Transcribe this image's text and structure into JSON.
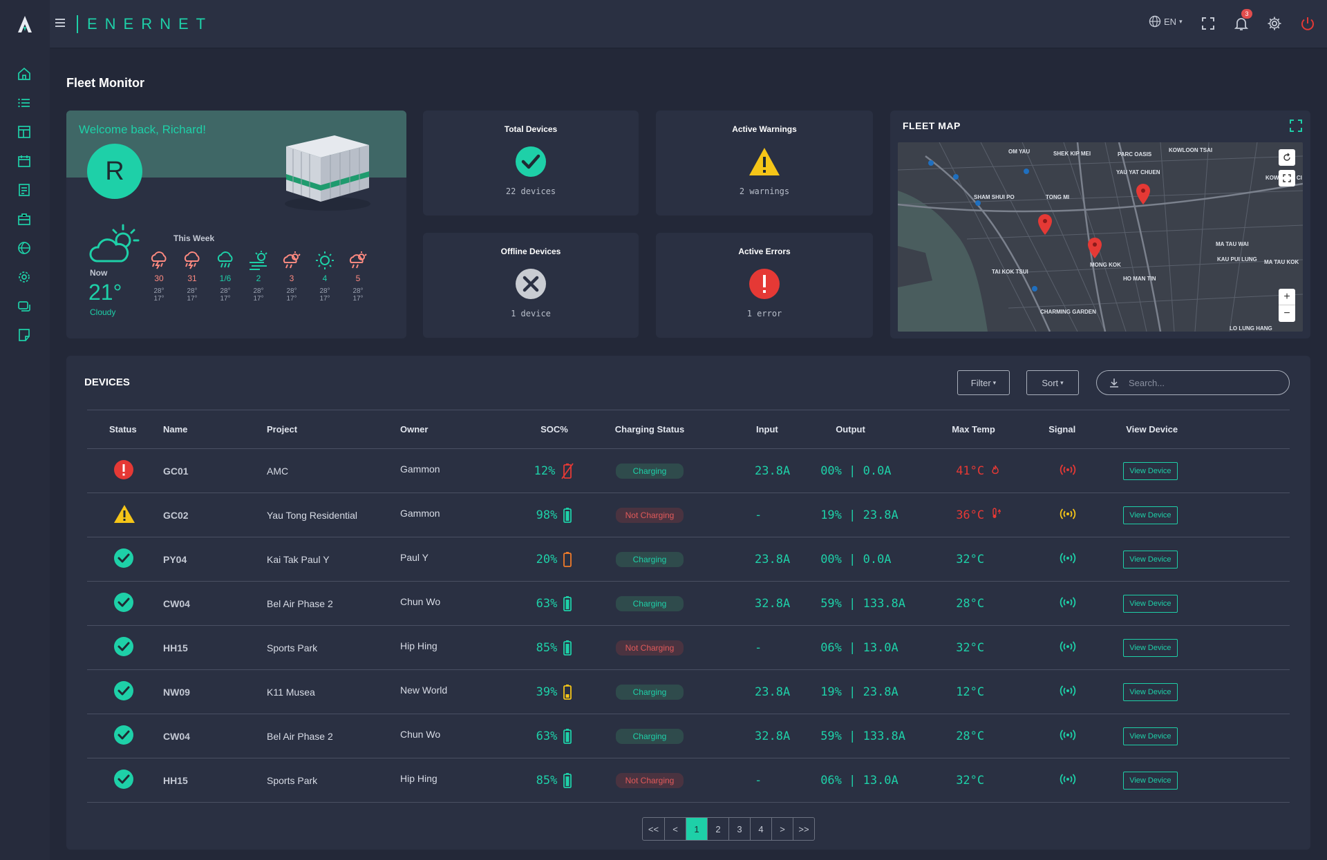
{
  "app": {
    "brand": "ENERNET",
    "language": "EN",
    "notification_count": "3"
  },
  "page": {
    "title": "Fleet Monitor"
  },
  "welcome": {
    "greeting": "Welcome back, Richard!",
    "avatar_initial": "R",
    "now_label": "Now",
    "now_temp": "21°",
    "now_condition": "Cloudy",
    "week_label": "This Week",
    "forecast": [
      {
        "day": "30",
        "hi": "28°",
        "lo": "17°",
        "icon": "thunder-rain-icon"
      },
      {
        "day": "31",
        "hi": "28°",
        "lo": "17°",
        "icon": "thunder-rain-icon"
      },
      {
        "day": "1/6",
        "hi": "28°",
        "lo": "17°",
        "icon": "rain-icon"
      },
      {
        "day": "2",
        "hi": "28°",
        "lo": "17°",
        "icon": "windy-sun-icon"
      },
      {
        "day": "3",
        "hi": "28°",
        "lo": "17°",
        "icon": "sun-rain-icon"
      },
      {
        "day": "4",
        "hi": "28°",
        "lo": "17°",
        "icon": "sun-icon"
      },
      {
        "day": "5",
        "hi": "28°",
        "lo": "17°",
        "icon": "sun-rain-icon"
      }
    ]
  },
  "stats": {
    "total": {
      "title": "Total Devices",
      "value": "22 devices"
    },
    "warnings": {
      "title": "Active Warnings",
      "value": "2 warnings"
    },
    "offline": {
      "title": "Offline Devices",
      "value": "1 device"
    },
    "errors": {
      "title": "Active Errors",
      "value": "1 error"
    }
  },
  "map": {
    "title": "FLEET MAP",
    "labels": [
      "OM YAU",
      "SHEK KIP MEI",
      "PARC OASIS",
      "KOWLOON TSAI",
      "SHAM SHUI PO",
      "TONG MI",
      "YAU YAT CHUEN",
      "KOWLOON CI",
      "MA TAU WAI",
      "KAU PUI LUNG",
      "MA TAU KOK",
      "TAI KOK TSUI",
      "MONG KOK",
      "HO MAN TIN",
      "CHARMING GARDEN",
      "LO LUNG HANG"
    ]
  },
  "devices": {
    "title": "DEVICES",
    "filter_label": "Filter",
    "sort_label": "Sort",
    "search_placeholder": "Search...",
    "columns": [
      "Status",
      "Name",
      "Project",
      "Owner",
      "SOC%",
      "Charging Status",
      "Input",
      "Output",
      "Max Temp",
      "Signal",
      "View Device"
    ],
    "view_label": "View Device",
    "rows": [
      {
        "status": "error",
        "name": "GC01",
        "project": "AMC",
        "owner": "Gammon",
        "soc": "12%",
        "battery": "empty",
        "charging": "Charging",
        "charging_on": true,
        "input": "23.8A",
        "output": "00% | 0.0A",
        "temp": "41°C",
        "temp_alert": "fire",
        "signal": "red"
      },
      {
        "status": "warning",
        "name": "GC02",
        "project": "Yau Tong Residential",
        "owner": "Gammon",
        "soc": "98%",
        "battery": "full",
        "charging": "Not Charging",
        "charging_on": false,
        "input": "-",
        "output": "19% | 23.8A",
        "temp": "36°C",
        "temp_alert": "thermo",
        "signal": "yellow"
      },
      {
        "status": "ok",
        "name": "PY04",
        "project": "Kai Tak Paul Y",
        "owner": "Paul Y",
        "soc": "20%",
        "battery": "low",
        "charging": "Charging",
        "charging_on": true,
        "input": "23.8A",
        "output": "00% | 0.0A",
        "temp": "32°C",
        "temp_alert": "",
        "signal": "green"
      },
      {
        "status": "ok",
        "name": "CW04",
        "project": "Bel Air Phase 2",
        "owner": "Chun Wo",
        "soc": "63%",
        "battery": "full",
        "charging": "Charging",
        "charging_on": true,
        "input": "32.8A",
        "output": "59% | 133.8A",
        "temp": "28°C",
        "temp_alert": "",
        "signal": "green"
      },
      {
        "status": "ok",
        "name": "HH15",
        "project": "Sports Park",
        "owner": "Hip Hing",
        "soc": "85%",
        "battery": "full",
        "charging": "Not Charging",
        "charging_on": false,
        "input": "-",
        "output": "06% | 13.0A",
        "temp": "32°C",
        "temp_alert": "",
        "signal": "green"
      },
      {
        "status": "ok",
        "name": "NW09",
        "project": "K11 Musea",
        "owner": "New World",
        "soc": "39%",
        "battery": "mid",
        "charging": "Charging",
        "charging_on": true,
        "input": "23.8A",
        "output": "19% | 23.8A",
        "temp": "12°C",
        "temp_alert": "",
        "signal": "green"
      },
      {
        "status": "ok",
        "name": "CW04",
        "project": "Bel Air Phase 2",
        "owner": "Chun Wo",
        "soc": "63%",
        "battery": "full",
        "charging": "Charging",
        "charging_on": true,
        "input": "32.8A",
        "output": "59% | 133.8A",
        "temp": "28°C",
        "temp_alert": "",
        "signal": "green"
      },
      {
        "status": "ok",
        "name": "HH15",
        "project": "Sports Park",
        "owner": "Hip Hing",
        "soc": "85%",
        "battery": "full",
        "charging": "Not Charging",
        "charging_on": false,
        "input": "-",
        "output": "06% | 13.0A",
        "temp": "32°C",
        "temp_alert": "",
        "signal": "green"
      }
    ]
  },
  "pagination": {
    "items": [
      "<<",
      "<",
      "1",
      "2",
      "3",
      "4",
      ">",
      ">>"
    ],
    "active": "1"
  },
  "colors": {
    "accent": "#1ed0a8",
    "error": "#e53935",
    "warning": "#f5c518",
    "battery_low": "#f07b2a"
  }
}
